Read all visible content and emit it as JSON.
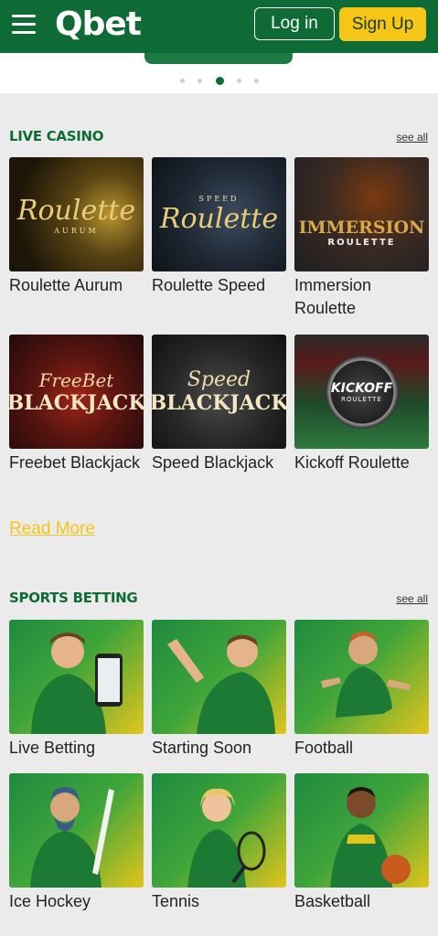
{
  "header": {
    "logo": "Qbet",
    "login_label": "Log in",
    "signup_label": "Sign Up"
  },
  "carousel": {
    "dot_count": 5,
    "active_index": 2
  },
  "live_casino": {
    "title": "LIVE CASINO",
    "see_all": "see all",
    "games": [
      {
        "label": "Roulette Aurum",
        "art_title": "Roulette",
        "art_sub": "AURUM"
      },
      {
        "label": "Roulette Speed",
        "art_title": "Roulette",
        "art_sub": "SPEED"
      },
      {
        "label": "Immersion Roulette",
        "art_title": "IMMERSION",
        "art_sub": "ROULETTE"
      },
      {
        "label": "Freebet Blackjack",
        "art_title": "FreeBet",
        "art_sub": "BLACKJACK"
      },
      {
        "label": "Speed Blackjack",
        "art_title": "Speed",
        "art_sub": "BLACKJACK"
      },
      {
        "label": "Kickoff Roulette",
        "art_title": "KICKOFF",
        "art_sub": "ROULETTE"
      }
    ],
    "read_more": "Read More"
  },
  "sports_betting": {
    "title": "SPORTS BETTING",
    "see_all": "see all",
    "items": [
      {
        "label": "Live Betting"
      },
      {
        "label": "Starting Soon"
      },
      {
        "label": "Football"
      },
      {
        "label": "Ice Hockey"
      },
      {
        "label": "Tennis"
      },
      {
        "label": "Basketball"
      }
    ]
  },
  "colors": {
    "brand_green": "#0e6b36",
    "accent_yellow": "#f5c518"
  }
}
